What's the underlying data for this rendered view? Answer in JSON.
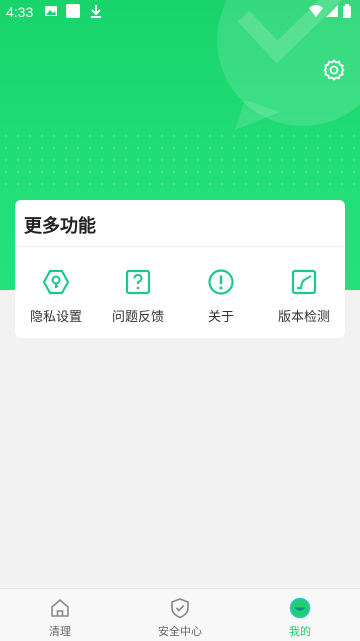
{
  "statusbar": {
    "time": "4:33",
    "left_icons": [
      "image-icon",
      "app-icon",
      "download-icon"
    ],
    "right_icons": [
      "wifi-icon",
      "signal-icon",
      "battery-icon"
    ]
  },
  "header": {
    "settings_icon": "gear-icon",
    "background_icon": "chat-check-icon"
  },
  "more_features": {
    "title": "更多功能",
    "items": [
      {
        "label": "隐私设置",
        "icon": "privacy-icon"
      },
      {
        "label": "问题反馈",
        "icon": "feedback-icon"
      },
      {
        "label": "关于",
        "icon": "about-icon"
      },
      {
        "label": "版本检测",
        "icon": "version-check-icon"
      }
    ]
  },
  "bottom_nav": {
    "items": [
      {
        "label": "清理",
        "icon": "home-icon",
        "active": false
      },
      {
        "label": "安全中心",
        "icon": "shield-check-icon",
        "active": false
      },
      {
        "label": "我的",
        "icon": "profile-icon",
        "active": true
      }
    ]
  },
  "colors": {
    "brand_green": "#1fcf6e",
    "icon_teal": "#1cc98a",
    "page_bg": "#f2f2f2"
  }
}
